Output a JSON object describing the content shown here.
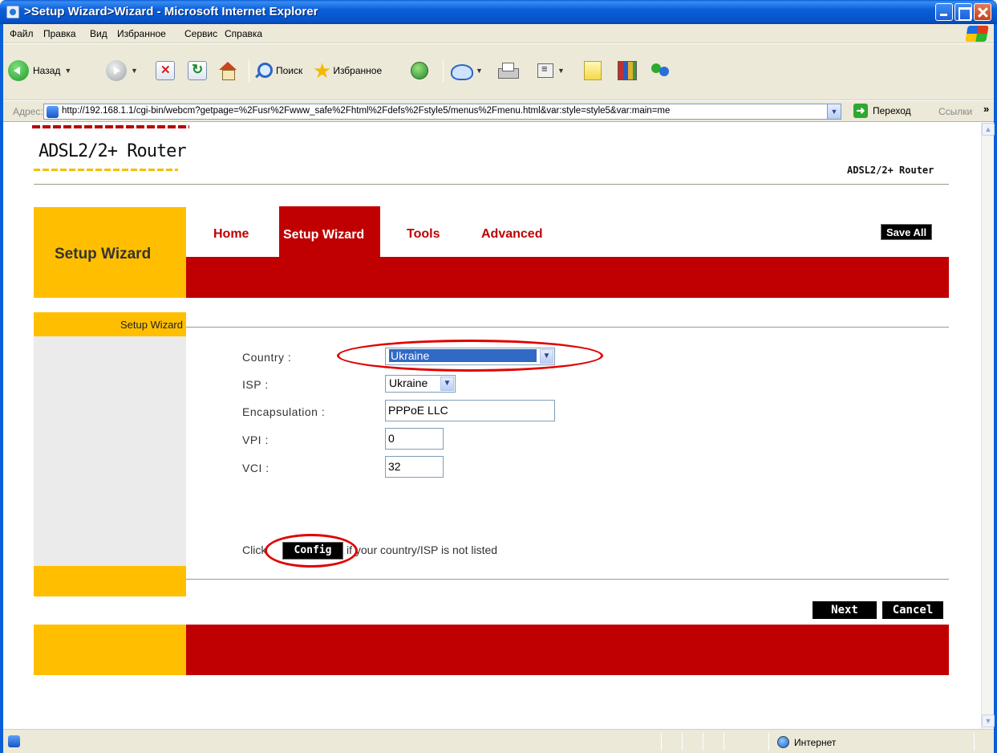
{
  "window": {
    "title": ">Setup Wizard>Wizard - Microsoft Internet Explorer"
  },
  "menu": {
    "items": [
      "Файл",
      "Правка",
      "Вид",
      "Избранное",
      "Сервис",
      "Справка"
    ]
  },
  "toolbar": {
    "back_label": "Назад",
    "search_label": "Поиск",
    "favorites_label": "Избранное"
  },
  "address": {
    "label": "Адрес:",
    "url": "http://192.168.1.1/cgi-bin/webcm?getpage=%2Fusr%2Fwww_safe%2Fhtml%2Fdefs%2Fstyle5/menus%2Fmenu.html&var:style=style5&var:main=me",
    "go_label": "Переход",
    "links_label": "Ссылки"
  },
  "status": {
    "zone": "Интернет"
  },
  "router": {
    "logo": "ADSL2/2+ Router",
    "brand": "ADSL2/2+ Router",
    "section_title": "Setup Wizard",
    "nav": {
      "home": "Home",
      "setup_wizard": "Setup Wizard",
      "tools": "Tools",
      "advanced": "Advanced"
    },
    "save_all": "Save All",
    "sidebar_item": "Setup Wizard",
    "form": {
      "country_label": "Country :",
      "country_value": "Ukraine",
      "isp_label": "ISP :",
      "isp_value": "Ukraine",
      "encapsulation_label": "Encapsulation :",
      "encapsulation_value": "PPPoE LLC",
      "vpi_label": "VPI :",
      "vpi_value": "0",
      "vci_label": "VCI :",
      "vci_value": "32"
    },
    "config_prefix": "Click",
    "config_button": "Config",
    "config_suffix": "if your country/ISP is not listed",
    "next_button": "Next",
    "cancel_button": "Cancel"
  },
  "colors": {
    "brand_red": "#c00000",
    "brand_yellow": "#ffbf00",
    "annotation_red": "#e00000"
  }
}
